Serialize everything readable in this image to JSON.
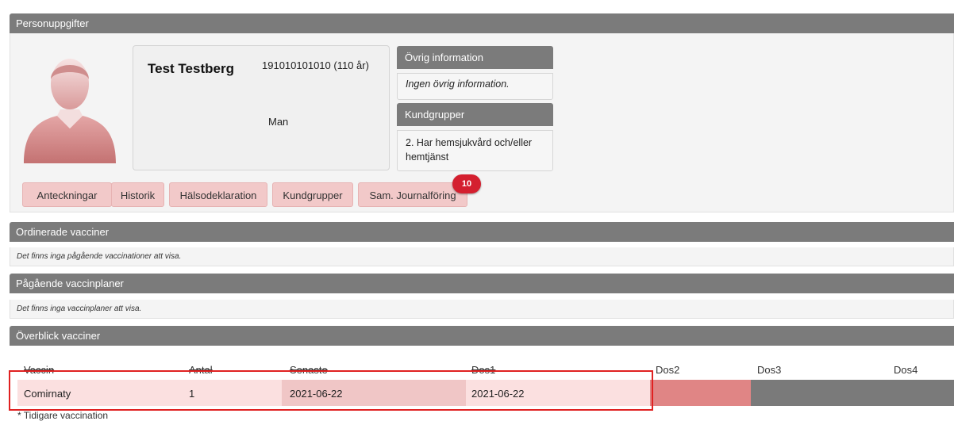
{
  "sections": {
    "personal": "Personuppgifter",
    "ordered": "Ordinerade vacciner",
    "ordered_empty": "Det finns inga pågående vaccinationer att visa.",
    "plans": "Pågående vaccinplaner",
    "plans_empty": "Det finns inga vaccinplaner att visa.",
    "overview": "Överblick vacciner"
  },
  "patient": {
    "name": "Test Testberg",
    "personal_number": "191010101010 (110 år)",
    "gender": "Man"
  },
  "other_info": {
    "title": "Övrig information",
    "text": "Ingen övrig information."
  },
  "customer_groups": {
    "title": "Kundgrupper",
    "text": "2. Har hemsjukvård och/eller hemtjänst"
  },
  "tabs": {
    "notes": "Anteckningar",
    "history": "Historik",
    "health": "Hälsodeklaration",
    "groups": "Kundgrupper",
    "journal": "Sam. Journalföring",
    "journal_badge": "10"
  },
  "table": {
    "headers": {
      "vaccine": "Vaccin",
      "count": "Antal",
      "latest": "Senaste",
      "dose1": "Dos1",
      "dose2": "Dos2",
      "dose3": "Dos3",
      "dose4": "Dos4"
    },
    "rows": [
      {
        "vaccine": "Comirnaty",
        "count": "1",
        "latest": "2021-06-22",
        "dose1": "2021-06-22"
      }
    ],
    "footnote": "* Tidigare vaccination"
  },
  "colors": {
    "header_bar": "#7b7b7b",
    "tab_bg": "#f2c9c9",
    "badge": "#d41f2f",
    "highlight": "#e02121",
    "dose2_fill": "#e08585",
    "dose_empty": "#7a7a7a"
  }
}
